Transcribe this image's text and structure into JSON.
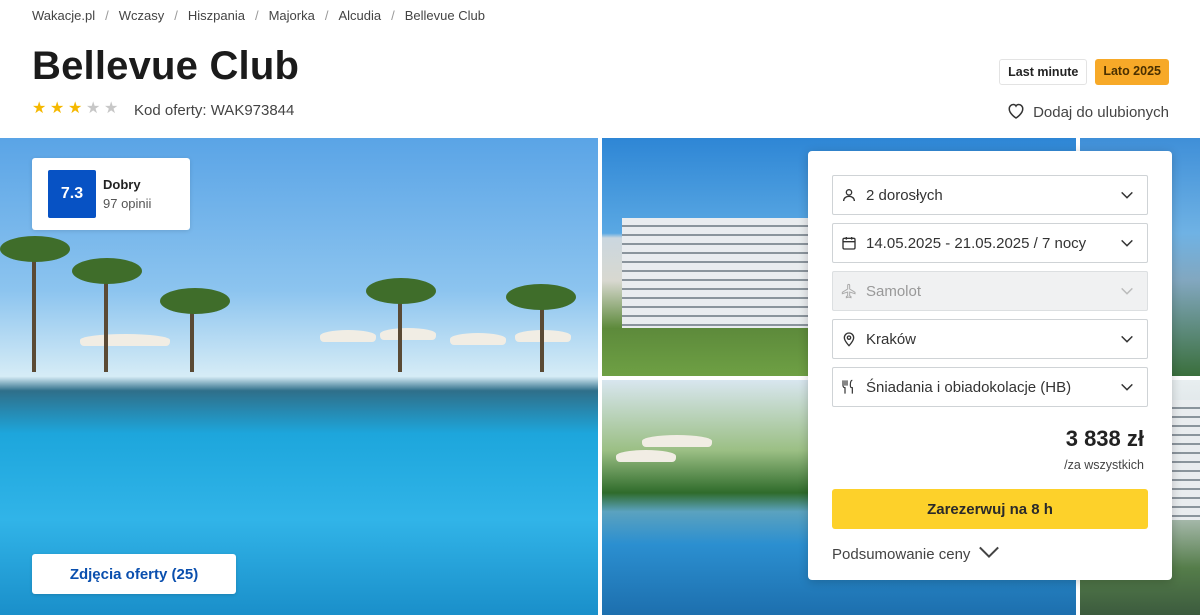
{
  "breadcrumb": [
    "Wakacje.pl",
    "Wczasy",
    "Hiszpania",
    "Majorka",
    "Alcudia",
    "Bellevue Club"
  ],
  "hotel": {
    "name": "Bellevue Club",
    "stars": 3,
    "stars_max": 5,
    "offer_code": "Kod oferty: WAK973844"
  },
  "badges": {
    "last_minute": "Last minute",
    "season": "Lato 2025"
  },
  "favorite_label": "Dodaj do ulubionych",
  "rating": {
    "score": "7.3",
    "label": "Dobry",
    "count": "97 opinii"
  },
  "photos_button": "Zdjęcia oferty (25)",
  "booking": {
    "travelers": "2 dorosłych",
    "dates": "14.05.2025 - 21.05.2025 / 7 nocy",
    "transport": "Samolot",
    "departure": "Kraków",
    "board": "Śniadania i obiadokolacje (HB)",
    "price": "3 838 zł",
    "price_note": "/za wszystkich",
    "reserve_label": "Zarezerwuj na 8 h",
    "summary_label": "Podsumowanie ceny"
  },
  "colors": {
    "accent_blue": "#0752c4",
    "reserve_yellow": "#fdd12a",
    "season_orange": "#f7a928",
    "star_gold": "#f5b800"
  },
  "icons": [
    "person-icon",
    "calendar-icon",
    "plane-icon",
    "location-pin-icon",
    "cutlery-icon",
    "chevron-down-icon",
    "heart-icon",
    "star-icon"
  ]
}
